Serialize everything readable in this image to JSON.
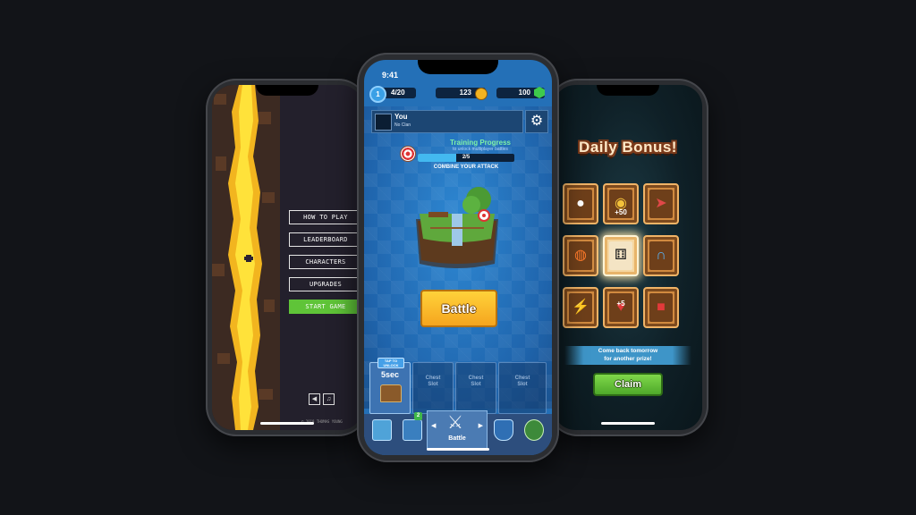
{
  "colors": {
    "background": "#121418",
    "left_menu_accent": "#5fc438",
    "battle_button": "#ffd23a",
    "claim_button": "#6cc63c"
  },
  "left_phone": {
    "menu": [
      "HOW TO PLAY",
      "LEADERBOARD",
      "CHARACTERS",
      "UPGRADES",
      "START GAME"
    ],
    "sound_icon": "sound-icon",
    "music_icon": "music-icon",
    "copyright": "© 2018 THOMAS YOUNG"
  },
  "center_phone": {
    "status_time": "9:41",
    "level": "1",
    "trophies": "4/20",
    "gold": "123",
    "gems": "100",
    "player_name": "You",
    "clan": "No Clan",
    "training": {
      "title": "Training Progress",
      "subtitle": "to unlock multiplayer battles",
      "progress_text": "2/5",
      "progress_fraction": 0.4,
      "caption": "COMBINE YOUR ATTACK"
    },
    "battle_button": "Battle",
    "chests": {
      "active_tag": "TAP TO UNLOCK",
      "active_timer": "5sec",
      "empty_slot_line1": "Chest",
      "empty_slot_line2": "Slot"
    },
    "tabs": {
      "cards_badge": "2",
      "battle_label": "Battle"
    }
  },
  "right_phone": {
    "title": "Daily Bonus!",
    "prizes": [
      {
        "icon": "bomb-icon",
        "label": ""
      },
      {
        "icon": "coins-icon",
        "label": "+50"
      },
      {
        "icon": "arrow-icon",
        "label": ""
      },
      {
        "icon": "rainbow-ball-icon",
        "label": ""
      },
      {
        "icon": "dice-icon",
        "label": ""
      },
      {
        "icon": "magnet-icon",
        "label": ""
      },
      {
        "icon": "anvil-icon",
        "label": ""
      },
      {
        "icon": "heart-icon",
        "label": "+5"
      },
      {
        "icon": "boxing-glove-icon",
        "label": ""
      }
    ],
    "selected_prize_index": 4,
    "banner_line1": "Come back tomorrow",
    "banner_line2": "for another prize!",
    "claim_button": "Claim"
  }
}
